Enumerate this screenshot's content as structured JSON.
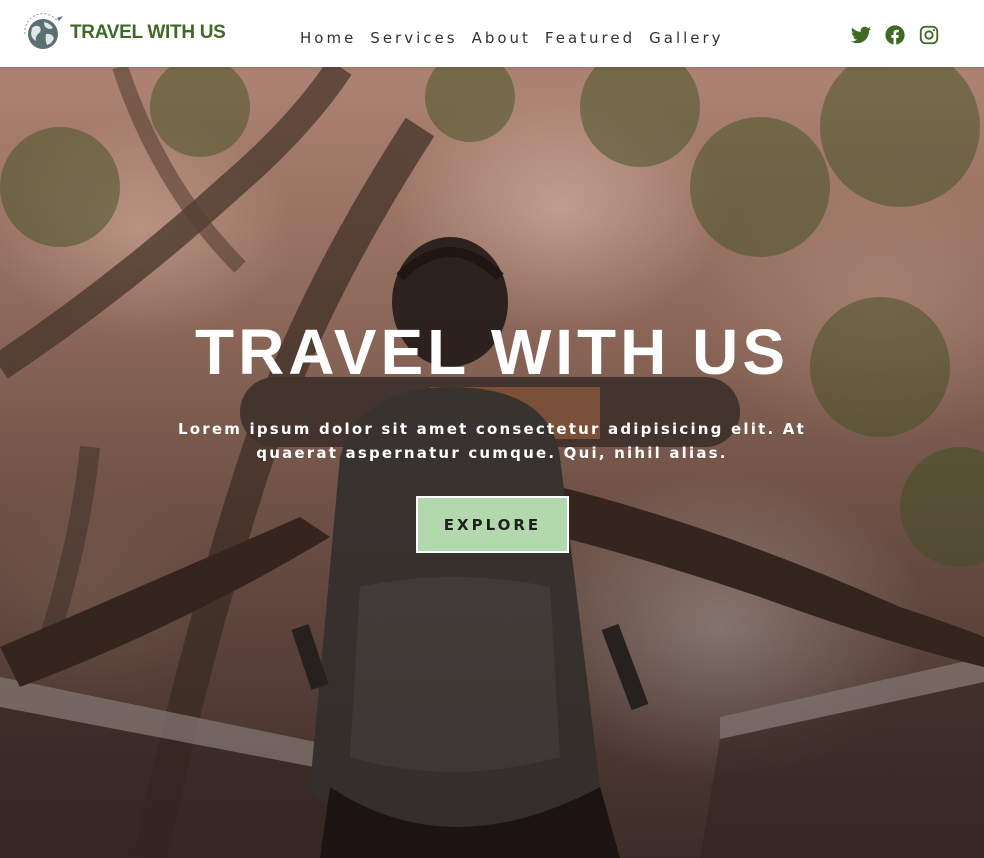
{
  "brand": {
    "name": "TRAVEL WITH US",
    "logo_icon": "globe-plane-icon"
  },
  "nav": {
    "items": [
      {
        "label": "Home"
      },
      {
        "label": "Services"
      },
      {
        "label": "About"
      },
      {
        "label": "Featured"
      },
      {
        "label": "Gallery"
      }
    ]
  },
  "socials": [
    {
      "icon": "twitter-icon"
    },
    {
      "icon": "facebook-icon"
    },
    {
      "icon": "instagram-icon"
    }
  ],
  "hero": {
    "title": "TRAVEL WITH US",
    "subtitle": "Lorem ipsum dolor sit amet consectetur adipisicing elit. At quaerat aspernatur cumque. Qui, nihil alias.",
    "cta_label": "EXPLORE",
    "background_image": "backpacker-on-bridge-in-forest"
  },
  "colors": {
    "brand_green": "#3f6a25",
    "cta_background": "#b3d8ae",
    "nav_text": "#333333",
    "hero_text": "#ffffff"
  }
}
